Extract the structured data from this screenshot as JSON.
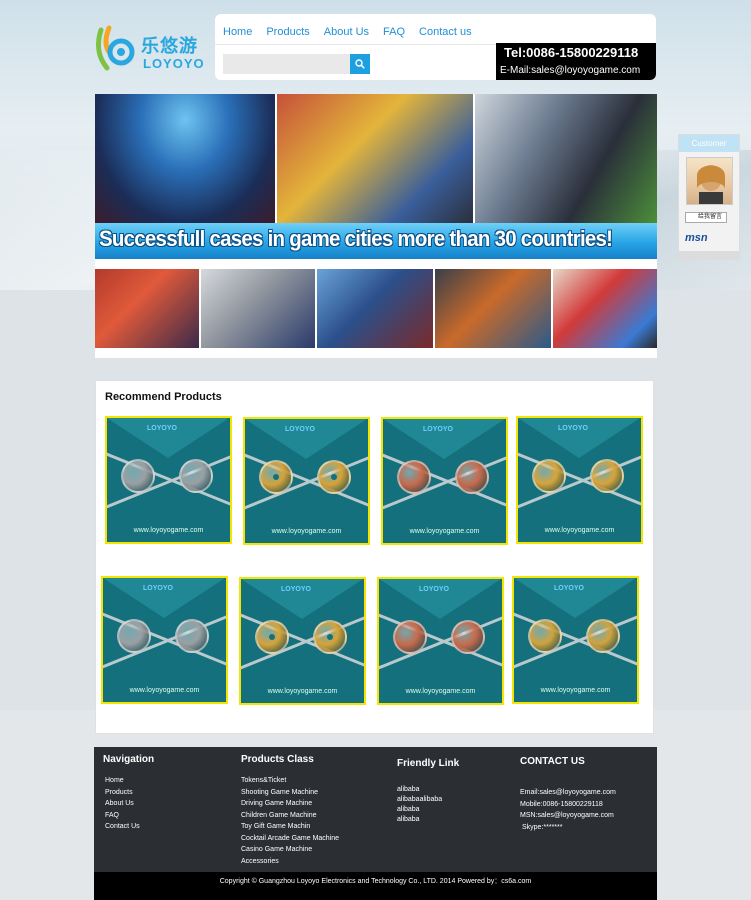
{
  "logo": {
    "cn": "乐悠游",
    "en": "LOYOYO"
  },
  "nav": [
    "Home",
    "Products",
    "About Us",
    "FAQ",
    "Contact us"
  ],
  "search": {
    "placeholder": ""
  },
  "contact": {
    "tel": "Tel:0086-15800229118",
    "email": "E-Mail:sales@loyoyogame.com"
  },
  "banner": {
    "slogan": "Successfull cases in game cities more than 30 countries!"
  },
  "customer": {
    "title": "Customer",
    "qq": "给我留言",
    "msn": "msn"
  },
  "recommend": {
    "title": "Recommend Products",
    "card_logo": "LOYOYO",
    "card_url": "www.loyoyogame.com",
    "coin_colors": [
      "#9aa0a3",
      "#d5a33a",
      "#c86a4c",
      "#d7a43a",
      "#9aa0a3",
      "#d5a33a",
      "#c86a4c",
      "#cfa33e"
    ]
  },
  "footer": {
    "nav_title": "Navigation",
    "nav_items": [
      "Home",
      "Products",
      "About Us",
      "FAQ",
      "Contact Us"
    ],
    "class_title": "Products Class",
    "class_items": [
      "Tokens&Ticket",
      "Shooting Game Machine",
      "Driving Game Machine",
      "Children Game Machine",
      "Toy Gift Game Machin",
      "Cocktail Arcade Game Machine",
      "Casino Game Machine",
      "Accessories"
    ],
    "link_title": "Friendly Link",
    "link_items": [
      "alibaba",
      "alibabaalibaba",
      "alibaba",
      "alibaba"
    ],
    "contact_title": "CONTACT US",
    "contact_items": [
      "Email:sales@loyoyogame.com",
      "Mobile:0086-15800229118",
      "MSN:sales@loyoyogame.com",
      "Skype:*******"
    ],
    "copyright": "Copyright © Guangzhou Loyoyo Electronics and Technology Co., LTD.  2014     Powered by：cs6a.com"
  }
}
